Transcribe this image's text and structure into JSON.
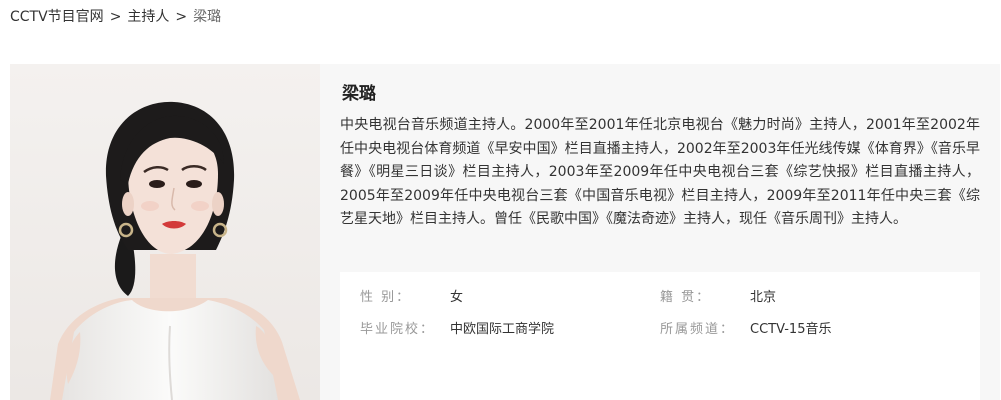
{
  "breadcrumb": {
    "items": [
      {
        "label": "CCTV节目官网"
      },
      {
        "label": "主持人"
      }
    ],
    "separator": ">",
    "current": "梁璐"
  },
  "profile": {
    "name": "梁璐",
    "bio": "中央电视台音乐频道主持人。2000年至2001年任北京电视台《魅力时尚》主持人，2001年至2002年任中央电视台体育频道《早安中国》栏目直播主持人，2002年至2003年任光线传媒《体育界》《音乐早餐》《明星三日谈》栏目主持人，2003年至2009年任中央电视台三套《综艺快报》栏目直播主持人，2005年至2009年任中央电视台三套《中国音乐电视》栏目主持人，2009年至2011年任中央三套《综艺星天地》栏目主持人。曾任《民歌中国》《魔法奇迹》主持人，现任《音乐周刊》主持人。",
    "details": {
      "gender_label": "性    别：",
      "gender": "女",
      "hometown_label": "籍    贯：",
      "hometown": "北京",
      "school_label": "毕业院校：",
      "school": "中欧国际工商学院",
      "channel_label": "所属频道：",
      "channel": "CCTV-15音乐"
    }
  },
  "colors": {
    "card_background": "#f7f7f7",
    "label_gray": "#999999",
    "text": "#333333"
  }
}
